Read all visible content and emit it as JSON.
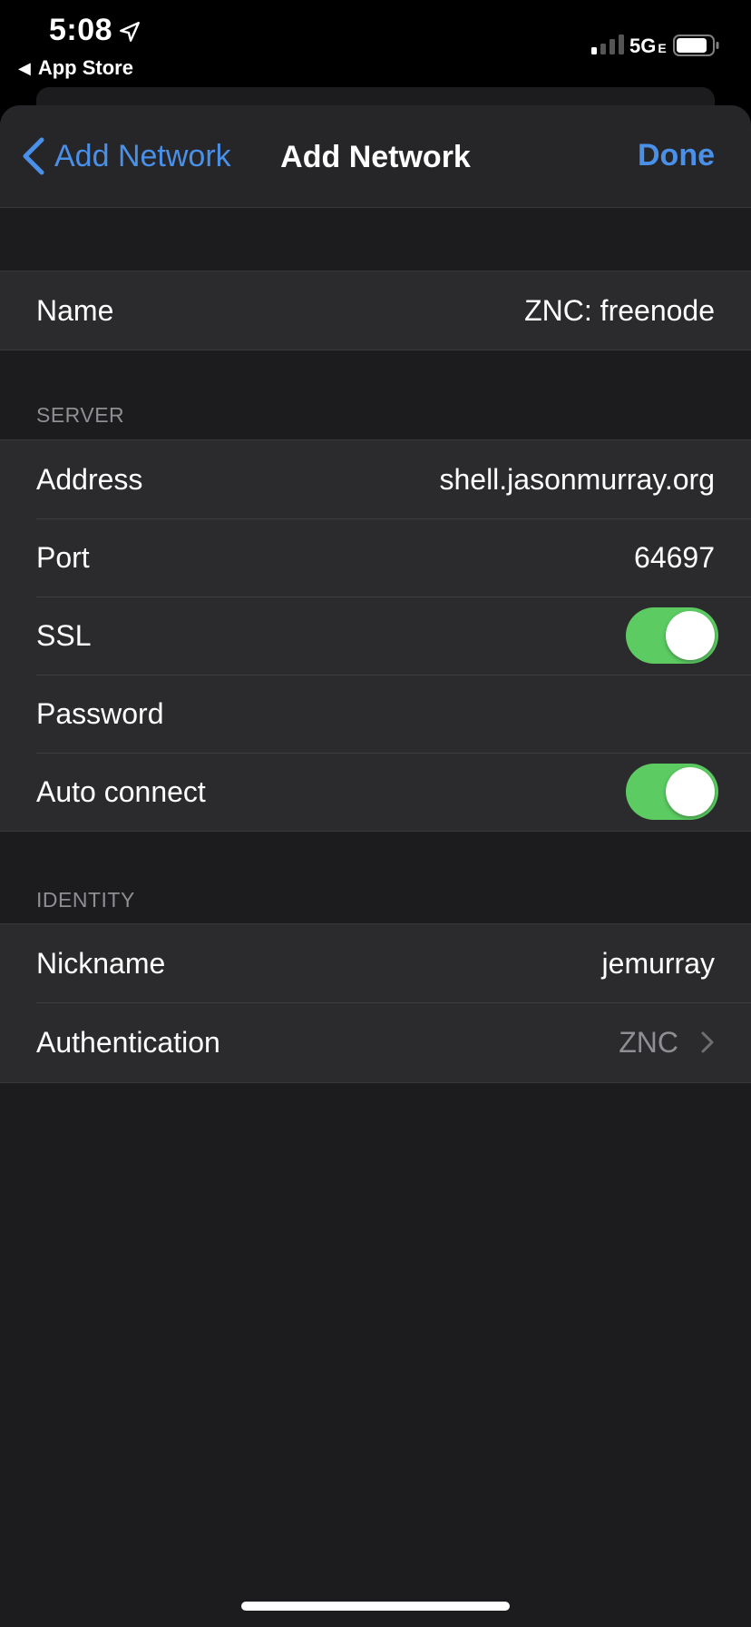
{
  "status_bar": {
    "time": "5:08",
    "back_app": "App Store",
    "network": "5G",
    "network_suffix": "E"
  },
  "nav": {
    "back_label": "Add Network",
    "title": "Add Network",
    "done_label": "Done"
  },
  "name_row": {
    "label": "Name",
    "value": "ZNC: freenode"
  },
  "server": {
    "header": "SERVER",
    "address": {
      "label": "Address",
      "value": "shell.jasonmurray.org"
    },
    "port": {
      "label": "Port",
      "value": "64697"
    },
    "ssl": {
      "label": "SSL",
      "on": true
    },
    "password": {
      "label": "Password",
      "value": ""
    },
    "auto_connect": {
      "label": "Auto connect",
      "on": true
    }
  },
  "identity": {
    "header": "IDENTITY",
    "nickname": {
      "label": "Nickname",
      "value": "jemurray"
    },
    "authentication": {
      "label": "Authentication",
      "value": "ZNC"
    }
  },
  "colors": {
    "accent": "#4a90e8",
    "toggle_on": "#5ccb62",
    "background": "#1c1c1e",
    "cell": "#2b2b2d"
  }
}
